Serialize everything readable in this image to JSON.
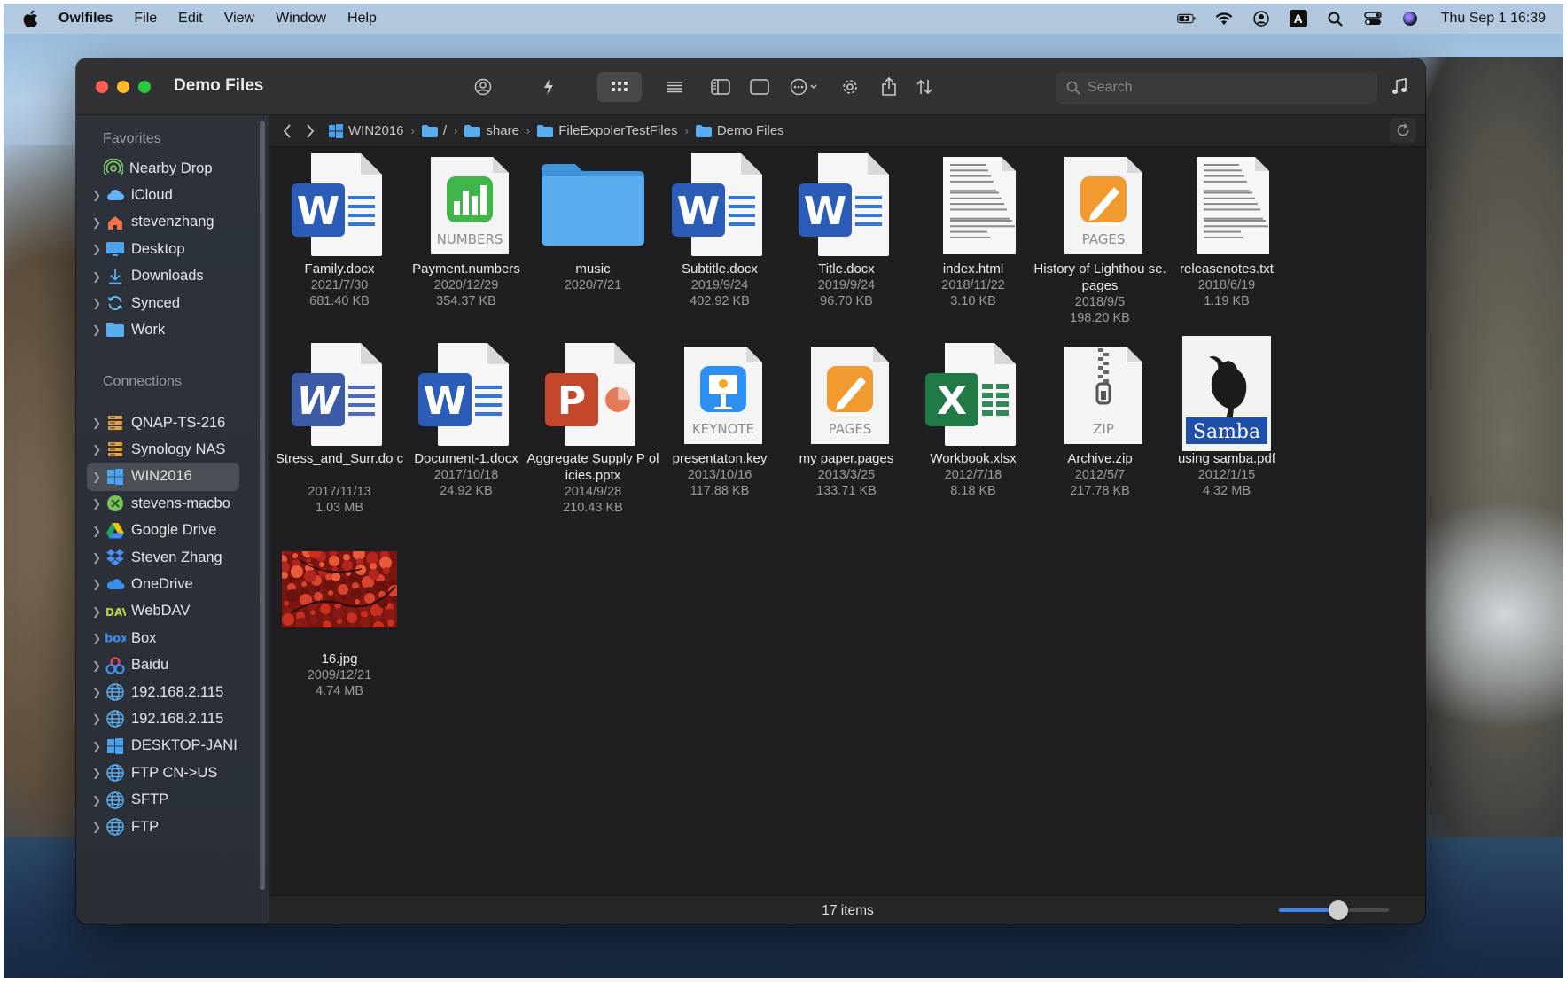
{
  "menubar": {
    "app_name": "Owlfiles",
    "menus": [
      "File",
      "Edit",
      "View",
      "Window",
      "Help"
    ],
    "input_source": "A",
    "clock": "Thu Sep 1  16:39"
  },
  "window": {
    "title": "Demo Files",
    "search_placeholder": "Search"
  },
  "sidebar": {
    "favorites_label": "Favorites",
    "connections_label": "Connections",
    "favorites": [
      {
        "label": "Nearby Drop",
        "icon": "airdrop-icon",
        "chevron": false
      },
      {
        "label": "iCloud",
        "icon": "icloud-icon",
        "chevron": true
      },
      {
        "label": "stevenzhang",
        "icon": "home-icon",
        "chevron": true
      },
      {
        "label": "Desktop",
        "icon": "desktop-icon",
        "chevron": true
      },
      {
        "label": "Downloads",
        "icon": "downloads-icon",
        "chevron": true
      },
      {
        "label": "Synced",
        "icon": "sync-icon",
        "chevron": true
      },
      {
        "label": "Work",
        "icon": "folder-icon",
        "chevron": true
      }
    ],
    "connections": [
      {
        "label": "QNAP-TS-216",
        "icon": "nas-icon"
      },
      {
        "label": "Synology NAS",
        "icon": "nas-icon"
      },
      {
        "label": "WIN2016",
        "icon": "windows-icon",
        "selected": true
      },
      {
        "label": "stevens-macbo",
        "icon": "mac-share-icon"
      },
      {
        "label": "Google Drive",
        "icon": "google-drive-icon"
      },
      {
        "label": "Steven Zhang",
        "icon": "dropbox-icon"
      },
      {
        "label": "OneDrive",
        "icon": "onedrive-icon"
      },
      {
        "label": "WebDAV",
        "icon": "webdav-icon"
      },
      {
        "label": "Box",
        "icon": "box-icon"
      },
      {
        "label": "Baidu",
        "icon": "baidu-icon"
      },
      {
        "label": "192.168.2.115",
        "icon": "globe-icon"
      },
      {
        "label": "192.168.2.115",
        "icon": "globe-icon"
      },
      {
        "label": "DESKTOP-JANI",
        "icon": "windows-icon"
      },
      {
        "label": "FTP CN->US",
        "icon": "globe-icon"
      },
      {
        "label": "SFTP",
        "icon": "globe-icon"
      },
      {
        "label": "FTP",
        "icon": "globe-icon"
      }
    ]
  },
  "path": {
    "crumbs": [
      "WIN2016",
      "/",
      "share",
      "FileExpolerTestFiles",
      "Demo Files"
    ]
  },
  "files": [
    {
      "name": "Family.docx",
      "date": "2021/7/30",
      "size": "681.40 KB",
      "kind": "word"
    },
    {
      "name": "Payment.numbers",
      "date": "2020/12/29",
      "size": "354.37 KB",
      "kind": "numbers",
      "badge": "NUMBERS"
    },
    {
      "name": "music",
      "date": "2020/7/21",
      "size": "",
      "kind": "folder"
    },
    {
      "name": "Subtitle.docx",
      "date": "2019/9/24",
      "size": "402.92 KB",
      "kind": "word"
    },
    {
      "name": "Title.docx",
      "date": "2019/9/24",
      "size": "96.70 KB",
      "kind": "word"
    },
    {
      "name": "index.html",
      "date": "2018/11/22",
      "size": "3.10 KB",
      "kind": "text"
    },
    {
      "name": "History of Lighthou se.pages",
      "date": "2018/9/5",
      "size": "198.20 KB",
      "kind": "pages",
      "badge": "PAGES"
    },
    {
      "name": "releasenotes.txt",
      "date": "2018/6/19",
      "size": "1.19 KB",
      "kind": "text"
    },
    {
      "name": "Stress_and_Surr.do c",
      "date": "2017/11/13",
      "size": "1.03 MB",
      "kind": "word-old"
    },
    {
      "name": "Document-1.docx",
      "date": "2017/10/18",
      "size": "24.92 KB",
      "kind": "word"
    },
    {
      "name": "Aggregate Supply P olicies.pptx",
      "date": "2014/9/28",
      "size": "210.43 KB",
      "kind": "ppt"
    },
    {
      "name": "presentaton.key",
      "date": "2013/10/16",
      "size": "117.88 KB",
      "kind": "keynote",
      "badge": "KEYNOTE"
    },
    {
      "name": "my paper.pages",
      "date": "2013/3/25",
      "size": "133.71 KB",
      "kind": "pages",
      "badge": "PAGES"
    },
    {
      "name": "Workbook.xlsx",
      "date": "2012/7/18",
      "size": "8.18 KB",
      "kind": "excel"
    },
    {
      "name": "Archive.zip",
      "date": "2012/5/7",
      "size": "217.78 KB",
      "kind": "zip",
      "badge": "ZIP"
    },
    {
      "name": "using samba.pdf",
      "date": "2012/1/15",
      "size": "4.32 MB",
      "kind": "pdf",
      "cover_title": "Samba"
    },
    {
      "name": "16.jpg",
      "date": "2009/12/21",
      "size": "4.74 MB",
      "kind": "photo"
    }
  ],
  "status": {
    "count": "17 items",
    "zoom_fraction": 0.55
  },
  "colors": {
    "accent": "#3d87f5",
    "word_blue": "#2b5cb8",
    "excel_green": "#1f7a45",
    "ppt_orange": "#c4462b",
    "folder_blue": "#5aaef0"
  }
}
